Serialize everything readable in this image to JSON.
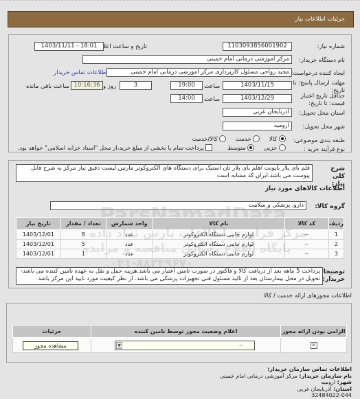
{
  "header": {
    "title": "جزئیات اطلاعات نیاز"
  },
  "details": {
    "need_number_label": "شماره نیاز:",
    "need_number": "1103093856001902",
    "announce_label": "تاریخ و ساعت اعلان عمومی:",
    "announce_value": "1403/11/11 - 18:01",
    "buyer_org_label": "نام دستگاه خریدار:",
    "buyer_org": "مرکز آموزشی درمانی امام خمینی",
    "creator_label": "ایجاد کننده درخواست:",
    "creator": "مجید  رواجی مسئول کارپردازی مرکز آموزشی درمانی امام خمینی",
    "contact_link": "اطلاعات تماس خریدار",
    "deadline_label": "مهلت ارسال پاسخ: تا تاریخ:",
    "deadline_date": "1403/11/15",
    "time_label": "ساعت",
    "deadline_time": "19:00",
    "days_value": "3",
    "days_label": "روز و",
    "remaining_time": "10:16:36",
    "remaining_label": "ساعت باقی مانده",
    "price_validity_label": "حداقل تاریخ اعتبار قیمت: تا تاریخ:",
    "price_validity_date": "1403/12/29",
    "price_validity_time": "14:00",
    "province_label": "استان محل تحویل:",
    "province": "آذربایجان غربی",
    "city_label": "شهر محل تحویل:",
    "city": "ارومیه",
    "category_label": "طبقه بندی موضوعی:",
    "category_options": [
      {
        "label": "کالا",
        "selected": true
      },
      {
        "label": "خدمت",
        "selected": false
      },
      {
        "label": "کالا/خدمت",
        "selected": false
      }
    ],
    "process_label": "نوع فرآیند خرید :",
    "process_options": [
      {
        "label": "جزیی",
        "selected": false
      },
      {
        "label": "متوسط",
        "selected": true
      }
    ],
    "payment_checkbox_label": "پرداخت تمام یا بخشی از مبلغ خرید،از محل \"اسناد خزانه اسلامی\" خواهد بود.",
    "payment_checked": false
  },
  "description": {
    "label": "شرح کلی نیاز:",
    "text": "قلم بای پلار بایونت /قلم بای پلار تان استیک برای دستگاه های الکتروکوتر مارتین.لیست دقیق نیاز مرکز به شرح فایل پیوست می باشد.ایران کد مشابه است"
  },
  "goods": {
    "section_title": "اطلاعات کالاهای مورد نیاز",
    "group_label": "گروه کالا:",
    "group_value": "دارو، پزشکی و سلامت",
    "columns": [
      "ردیف",
      "کد کالا",
      "نام کالا",
      "واحد شمارش",
      "تعداد / مقدار",
      "تاریخ نیاز"
    ],
    "rows": [
      [
        "1",
        "--",
        "لوازم جانبی دستگاه الکتروکوتر",
        "عدد",
        "8",
        "1403/12/01"
      ],
      [
        "2",
        "--",
        "لوازم جانبی دستگاه الکتروکوتر",
        "عدد",
        "5",
        "1403/12/01"
      ],
      [
        "3",
        "--",
        "لوازم جانبی دستگاه الکتروکوتر",
        "عدد",
        "1",
        "1403/12/01"
      ]
    ]
  },
  "buyer_notes": {
    "label": "توضیحات خریدار:",
    "text": "پرداخت 5 ماهه بعد از دریافت کالا و فاکتور در صورت تامین اعتبار می باشد.هزینه حمل و نقل به عهده تامین کننده می باشد- تحویل در محل بیمارستان بعد از تائید مسئول فنی تجهیزات پزشکی می باشد. از نظر کیفیت مورد تایید این مرکز باشد"
  },
  "licenses": {
    "section_title": "اطلاعات مجوزهای ارائه خدمت / کالا",
    "columns": [
      "الزامی بودن ارائه مجوز",
      "اعلام وضعیت مجوز توسط تامین کننده",
      "جزئیات"
    ],
    "select_value": "--",
    "view_button": "مشاهده مجوز"
  },
  "contact": {
    "title": "اطلاعات تماس سازمان خریدار:",
    "org_label": "نام سازمان خریدار:",
    "org_value": "مرکز آموزشی درمانی امام خمینی",
    "city_label": "شهر:",
    "city_value": "ارومیه",
    "province_label": "استان:",
    "province_value": "آذربایجان غربی",
    "phone_partial": "32484022-044"
  },
  "watermark": {
    "brand": "ParsNamadData",
    "line1": "مرکز فراوری اطلاعات پارس نماد داده",
    "line2": "پایگاه اطلاع رسانی مناقصه و مزایده",
    "phone": "۰۲۱-۸۸۳۴۹۶۷۰"
  }
}
